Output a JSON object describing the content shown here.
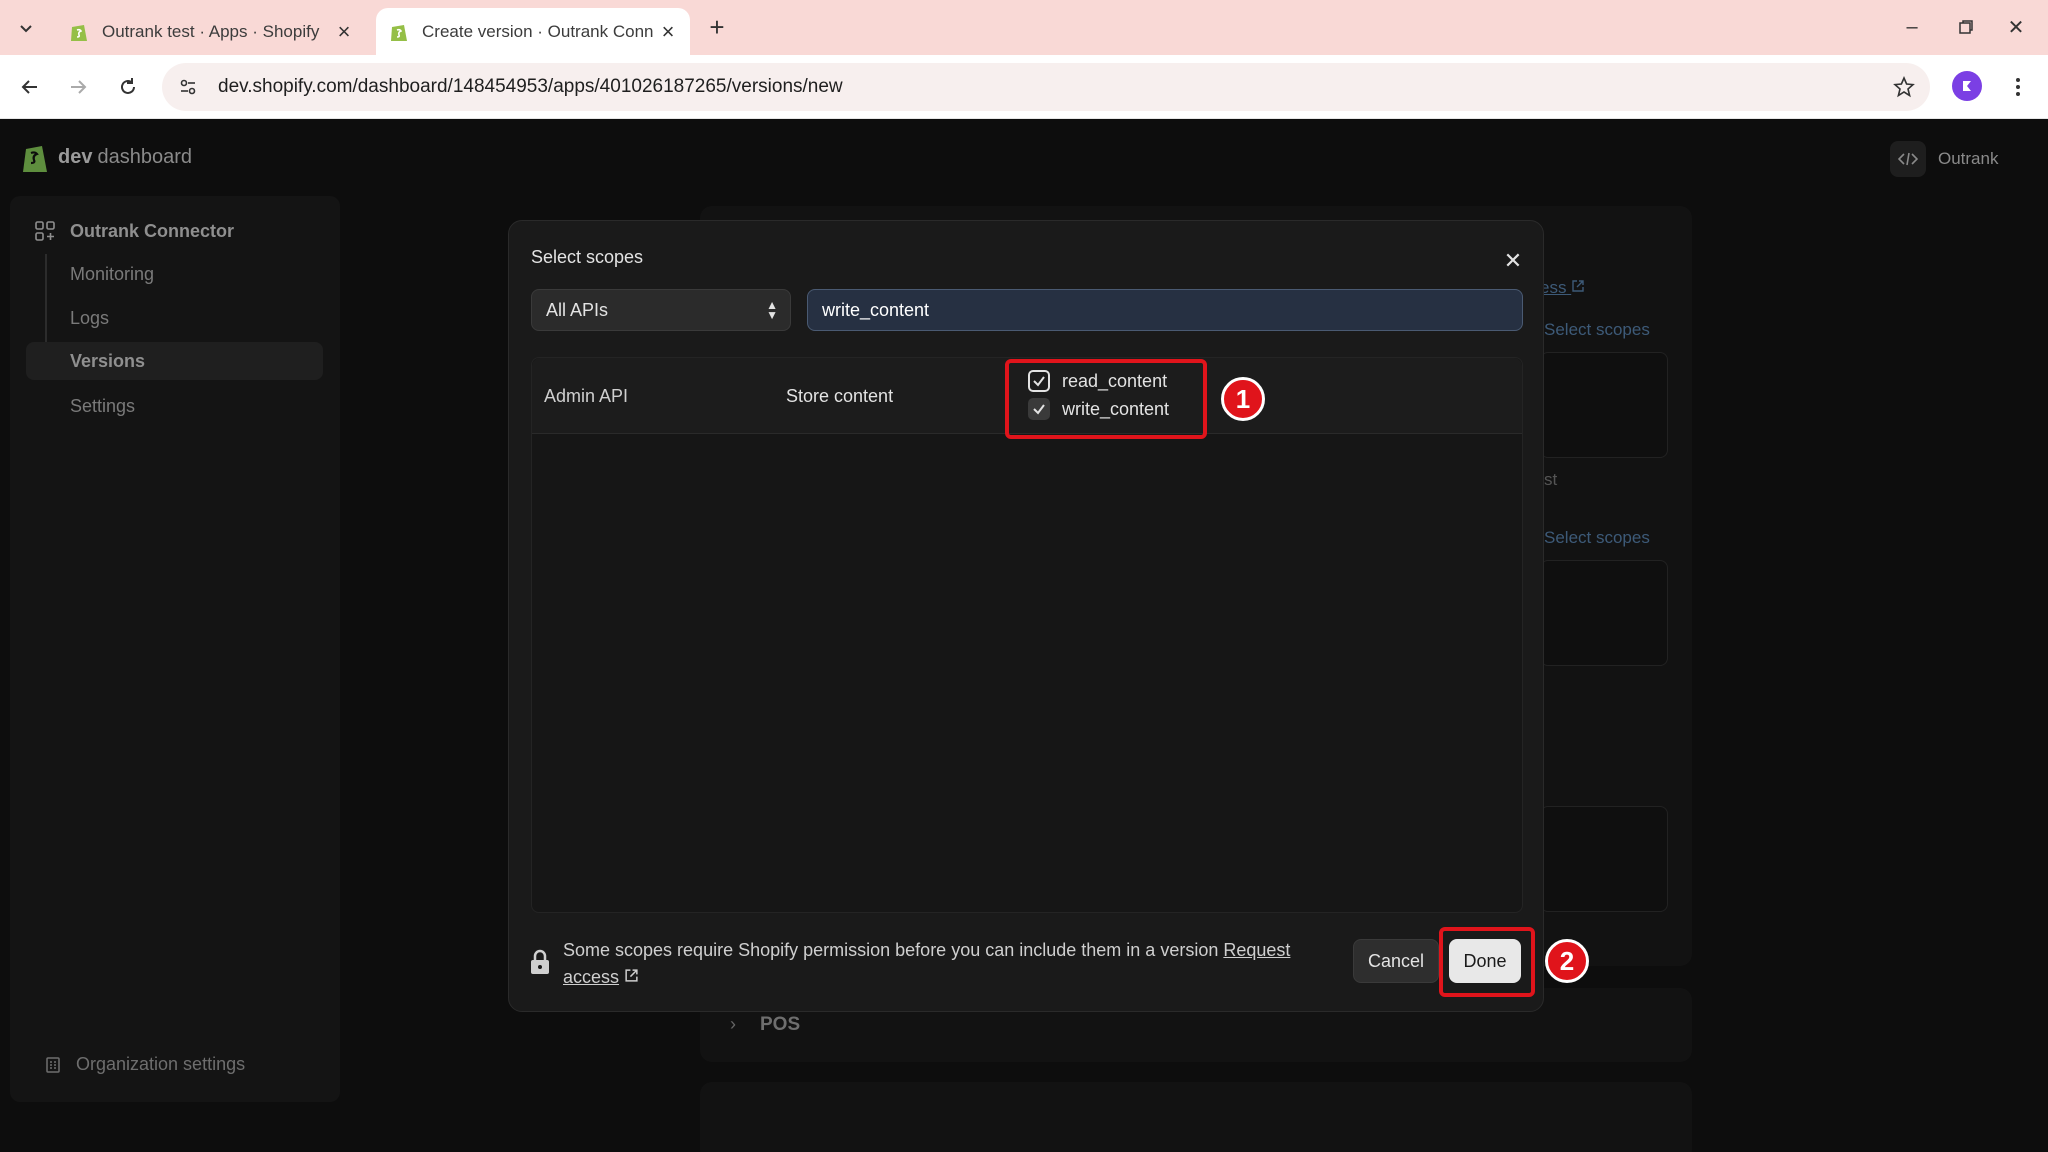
{
  "browser": {
    "tabs": [
      {
        "title": "Outrank test · Apps · Shopify",
        "active": false
      },
      {
        "title": "Create version · Outrank Conne",
        "active": true
      }
    ],
    "url": "dev.shopify.com/dashboard/148454953/apps/401026187265/versions/new"
  },
  "header": {
    "brand_bold": "dev",
    "brand_rest": "dashboard",
    "org": "Outrank"
  },
  "sidebar": {
    "app_name": "Outrank Connector",
    "items": [
      {
        "label": "Monitoring"
      },
      {
        "label": "Logs"
      },
      {
        "label": "Versions"
      },
      {
        "label": "Settings"
      }
    ],
    "bottom": "Organization settings"
  },
  "background": {
    "link_fragment": "ess",
    "select_scopes_1": "Select scopes",
    "text_fragment": "st",
    "select_scopes_2": "Select scopes",
    "pos_label": "POS"
  },
  "modal": {
    "title": "Select scopes",
    "api_filter": "All APIs",
    "search_value": "write_content",
    "row": {
      "api": "Admin API",
      "group": "Store content",
      "scopes": [
        "read_content",
        "write_content"
      ]
    },
    "footer_text": "Some scopes require Shopify permission before you can include them in a version",
    "footer_link_1": "Request",
    "footer_link_2": "access",
    "cancel_label": "Cancel",
    "done_label": "Done"
  },
  "annotations": {
    "one": "1",
    "two": "2"
  },
  "colors": {
    "annotation": "#e0141b",
    "shopify_green": "#95bf47",
    "tabbar": "#f9d9d6"
  }
}
